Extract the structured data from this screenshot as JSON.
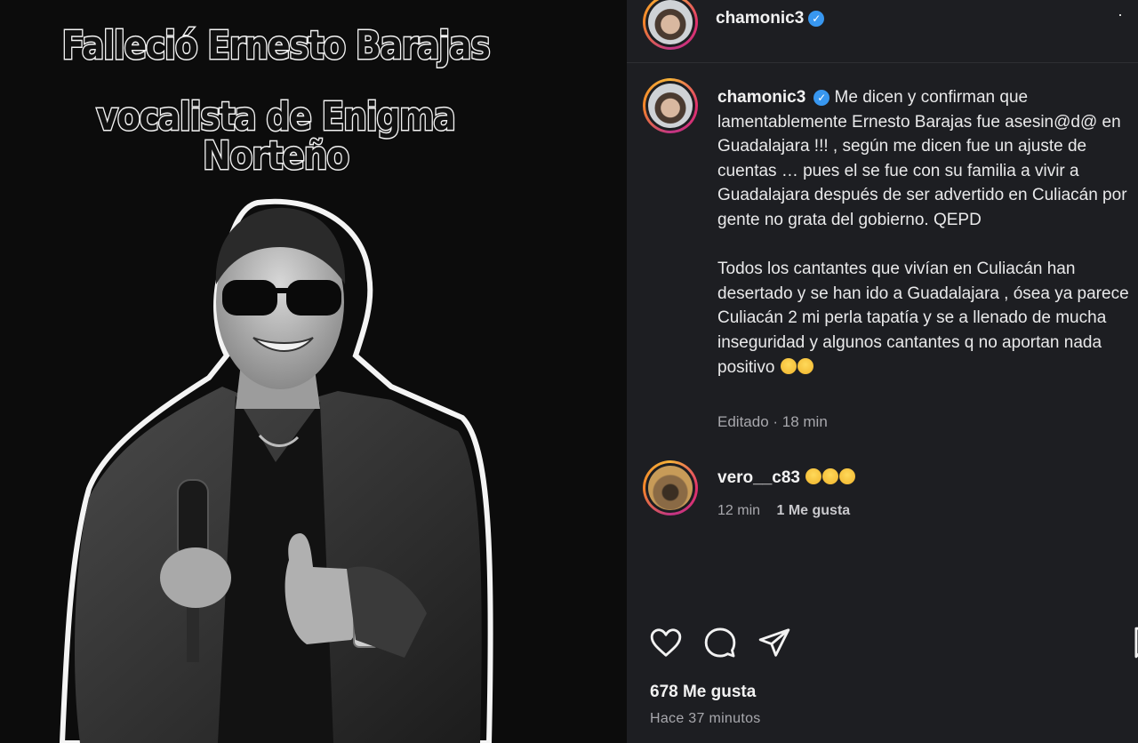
{
  "image": {
    "headline_line1": "Falleció Ernesto Barajas",
    "headline_line2": "vocalista de Enigma Norteño"
  },
  "post": {
    "header_username": "chamonic3",
    "caption_username": "chamonic3",
    "caption_para1": "Me dicen y confirman que lamentablemente Ernesto Barajas fue asesin@d@ en Guadalajara !!! , según me dicen fue un ajuste de cuentas … pues el se fue con su familia a vivir a Guadalajara después de ser advertido en Culiacán por gente no grata del gobierno. QEPD",
    "caption_para2": "Todos los cantantes que vivían en Culiacán han desertado y se han ido a Guadalajara , ósea ya parece Culiacán 2 mi perla tapatía y se a llenado de mucha inseguridad y algunos cantantes q no aportan nada positivo",
    "edited_meta": "Editado · 18 min",
    "likes": "678 Me gusta",
    "time_ago": "Hace 37 minutos"
  },
  "comment": {
    "username": "vero__c83",
    "time": "12 min",
    "likes": "1 Me gusta"
  },
  "icons": {
    "verified": "verified-badge-icon",
    "like": "heart-icon",
    "comment": "speech-bubble-icon",
    "share": "paper-plane-icon",
    "save": "bookmark-icon",
    "more": "more-dots-icon"
  },
  "colors": {
    "panel_bg": "#1d1e22",
    "verified_blue": "#3897f0",
    "text": "#e9e9ea",
    "muted": "#a8a8ad"
  }
}
